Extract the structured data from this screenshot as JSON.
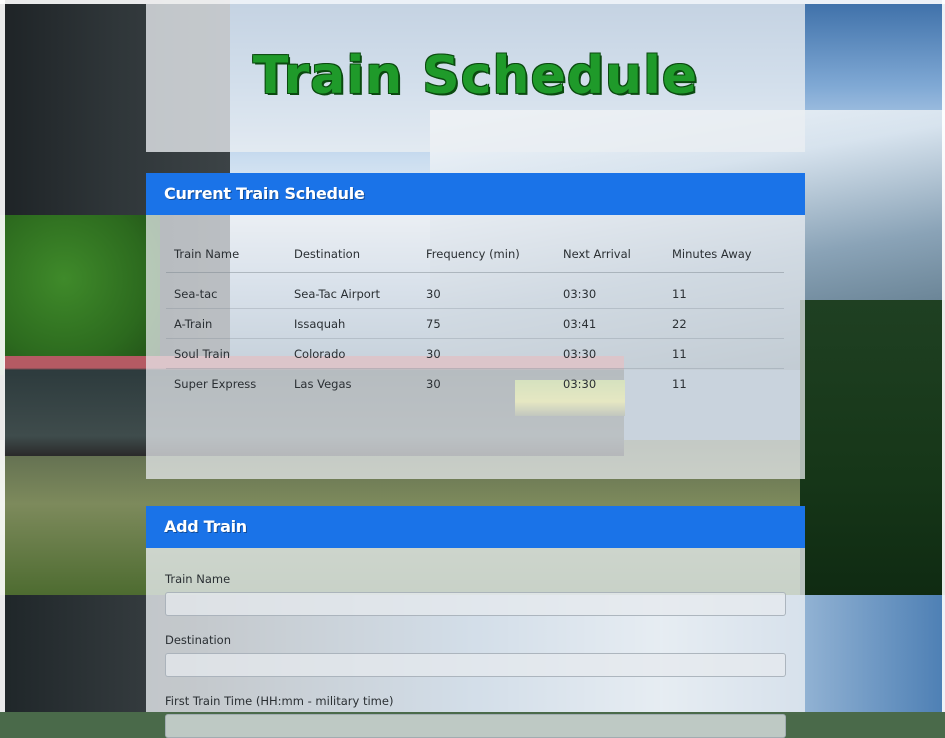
{
  "page": {
    "title": "Train Schedule"
  },
  "schedule": {
    "heading": "Current Train Schedule",
    "columns": [
      "Train Name",
      "Destination",
      "Frequency (min)",
      "Next Arrival",
      "Minutes Away"
    ],
    "rows": [
      {
        "name": "Sea-tac",
        "destination": "Sea-Tac Airport",
        "frequency": "30",
        "next_arrival": "03:30",
        "minutes_away": "11"
      },
      {
        "name": "A-Train",
        "destination": "Issaquah",
        "frequency": "75",
        "next_arrival": "03:41",
        "minutes_away": "22"
      },
      {
        "name": "Soul Train",
        "destination": "Colorado",
        "frequency": "30",
        "next_arrival": "03:30",
        "minutes_away": "11"
      },
      {
        "name": "Super Express",
        "destination": "Las Vegas",
        "frequency": "30",
        "next_arrival": "03:30",
        "minutes_away": "11"
      }
    ]
  },
  "add_train": {
    "heading": "Add Train",
    "fields": [
      {
        "label": "Train Name",
        "value": ""
      },
      {
        "label": "Destination",
        "value": ""
      },
      {
        "label": "First Train Time (HH:mm - military time)",
        "value": ""
      }
    ]
  },
  "colors": {
    "title_green": "#1f9a2a",
    "header_blue": "#1a73e8"
  }
}
